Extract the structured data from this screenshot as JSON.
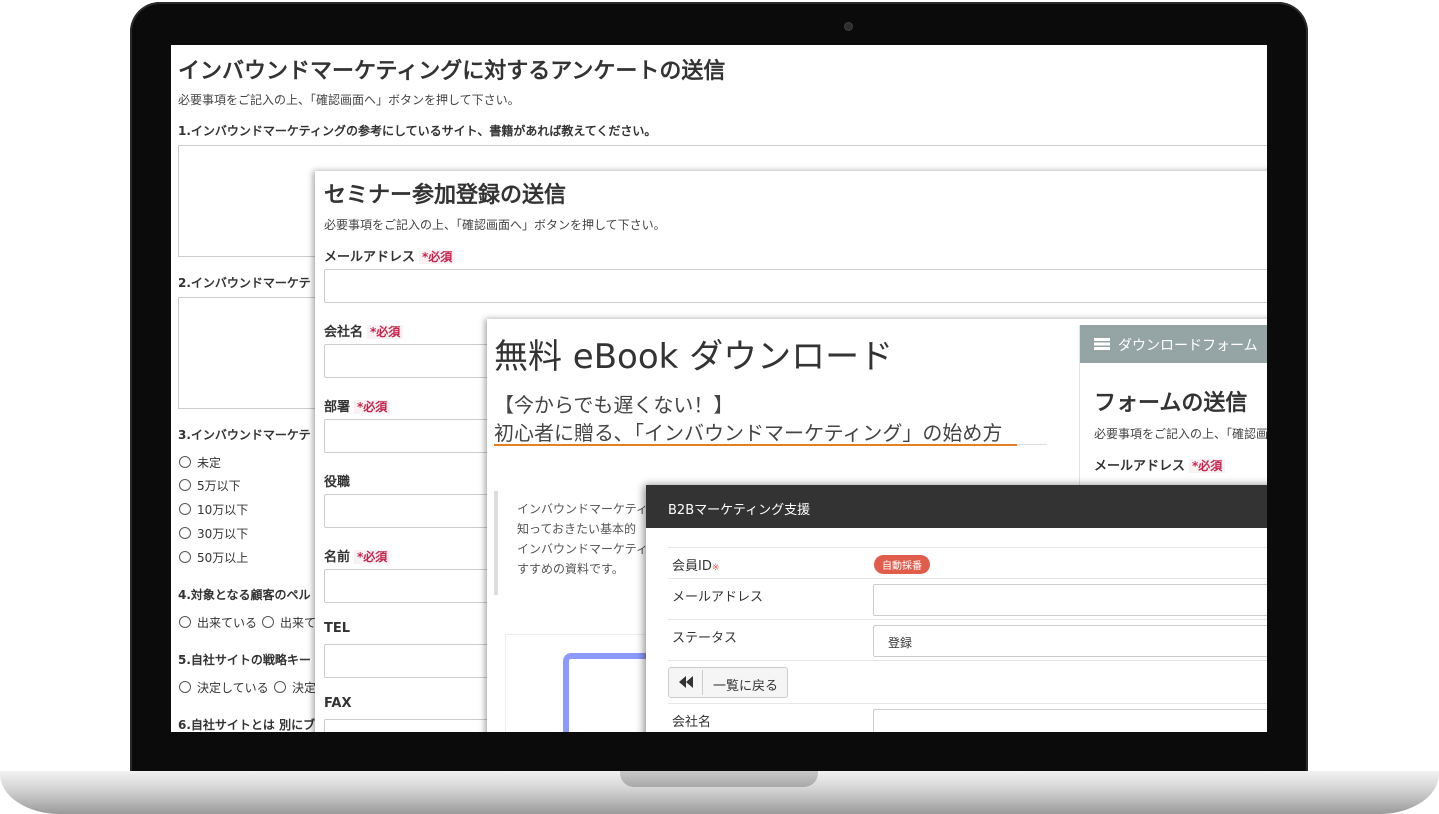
{
  "survey": {
    "title": "インバウンドマーケティングに対するアンケートの送信",
    "subtitle": "必要事項をご記入の上、「確認画面へ」ボタンを押して下さい。",
    "q1": "1.インバウンドマーケティングの参考にしているサイト、書籍があれば教えてください。",
    "q2": "2.インバウンドマーケテ",
    "q3": "3.インバウンドマーケテ",
    "budget_options": [
      "未定",
      "5万以下",
      "10万以下",
      "30万以下",
      "50万以上"
    ],
    "q4": "4.対象となる顧客のペル",
    "q4_options": [
      "出来ている",
      "出来て"
    ],
    "q5": "5.自社サイトの戦略キー",
    "q5_options": [
      "決定している",
      "決定"
    ],
    "q6": "6.自社サイトとは 別にブ"
  },
  "seminar": {
    "title": "セミナー参加登録の送信",
    "subtitle": "必要事項をご記入の上、「確認画面へ」ボタンを押して下さい。",
    "required": "*必須",
    "fields": {
      "email": "メールアドレス",
      "company": "会社名",
      "department": "部署",
      "position": "役職",
      "name": "名前",
      "tel": "TEL",
      "fax": "FAX"
    }
  },
  "ebook": {
    "heading": "無料 eBook ダウンロード",
    "line1": "【今からでも遅くない！】",
    "line2": "初心者に贈る､「インバウンドマーケティング」の始め方",
    "desc": [
      "インバウンドマーケティ",
      "知っておきたい基本的",
      "インバウンドマーケティ",
      "すすめの資料です。"
    ],
    "sidebar_header": "ダウンロードフォーム",
    "form_title": "フォームの送信",
    "form_subtitle": "必要事項をご記入の上、「確認画",
    "email_label": "メールアドレス",
    "required": "*必須"
  },
  "b2b": {
    "header": "B2Bマーケティング支援",
    "member_id_label": "会員ID",
    "required_mark": "※",
    "auto_badge": "自動採番",
    "email_label": "メールアドレス",
    "status_label": "ステータス",
    "status_value": "登録",
    "back_button": "一覧に戻る",
    "company_label": "会社名"
  }
}
